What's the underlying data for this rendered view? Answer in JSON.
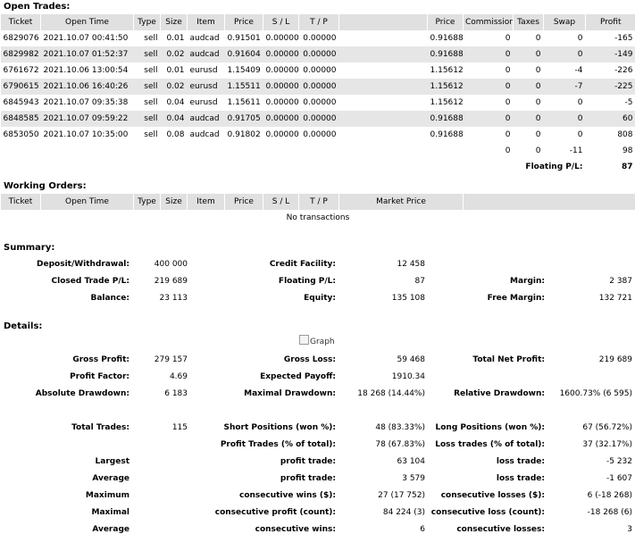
{
  "open_trades": {
    "title": "Open Trades:",
    "headers": [
      "Ticket",
      "Open Time",
      "Type",
      "Size",
      "Item",
      "Price",
      "S / L",
      "T / P",
      "",
      "Price",
      "Commission",
      "Taxes",
      "Swap",
      "Profit"
    ],
    "rows": [
      [
        "6829076",
        "2021.10.07 00:41:50",
        "sell",
        "0.01",
        "audcad",
        "0.91501",
        "0.00000",
        "0.00000",
        "",
        "0.91688",
        "0",
        "0",
        "0",
        "-165"
      ],
      [
        "6829982",
        "2021.10.07 01:52:37",
        "sell",
        "0.02",
        "audcad",
        "0.91604",
        "0.00000",
        "0.00000",
        "",
        "0.91688",
        "0",
        "0",
        "0",
        "-149"
      ],
      [
        "6761672",
        "2021.10.06 13:00:54",
        "sell",
        "0.01",
        "eurusd",
        "1.15409",
        "0.00000",
        "0.00000",
        "",
        "1.15612",
        "0",
        "0",
        "-4",
        "-226"
      ],
      [
        "6790615",
        "2021.10.06 16:40:26",
        "sell",
        "0.02",
        "eurusd",
        "1.15511",
        "0.00000",
        "0.00000",
        "",
        "1.15612",
        "0",
        "0",
        "-7",
        "-225"
      ],
      [
        "6845943",
        "2021.10.07 09:35:38",
        "sell",
        "0.04",
        "eurusd",
        "1.15611",
        "0.00000",
        "0.00000",
        "",
        "1.15612",
        "0",
        "0",
        "0",
        "-5"
      ],
      [
        "6848585",
        "2021.10.07 09:59:22",
        "sell",
        "0.04",
        "audcad",
        "0.91705",
        "0.00000",
        "0.00000",
        "",
        "0.91688",
        "0",
        "0",
        "0",
        "60"
      ],
      [
        "6853050",
        "2021.10.07 10:35:00",
        "sell",
        "0.08",
        "audcad",
        "0.91802",
        "0.00000",
        "0.00000",
        "",
        "0.91688",
        "0",
        "0",
        "0",
        "808"
      ]
    ],
    "totals": {
      "commission": "0",
      "taxes": "0",
      "swap": "-11",
      "profit": "98"
    },
    "floating_label": "Floating P/L:",
    "floating_value": "87"
  },
  "working_orders": {
    "title": "Working Orders:",
    "headers": [
      "Ticket",
      "Open Time",
      "Type",
      "Size",
      "Item",
      "Price",
      "S / L",
      "T / P",
      "Market Price",
      ""
    ],
    "empty_text": "No transactions"
  },
  "summary": {
    "title": "Summary:",
    "deposit_label": "Deposit/Withdrawal:",
    "deposit_value": "400 000",
    "credit_label": "Credit Facility:",
    "credit_value": "12 458",
    "closed_label": "Closed Trade P/L:",
    "closed_value": "219 689",
    "floating_label": "Floating P/L:",
    "floating_value": "87",
    "margin_label": "Margin:",
    "margin_value": "2 387",
    "balance_label": "Balance:",
    "balance_value": "23 113",
    "equity_label": "Equity:",
    "equity_value": "135 108",
    "free_margin_label": "Free Margin:",
    "free_margin_value": "132 721"
  },
  "details": {
    "title": "Details:",
    "graph_alt": "Graph",
    "rows": [
      {
        "l1": "Gross Profit:",
        "v1": "279 157",
        "l2": "Gross Loss:",
        "v2": "59 468",
        "l3": "Total Net Profit:",
        "v3": "219 689"
      },
      {
        "l1": "Profit Factor:",
        "v1": "4.69",
        "l2": "Expected Payoff:",
        "v2": "1910.34",
        "l3": "",
        "v3": ""
      },
      {
        "l1": "Absolute Drawdown:",
        "v1": "6 183",
        "l2": "Maximal Drawdown:",
        "v2": "18 268 (14.44%)",
        "l3": "Relative Drawdown:",
        "v3": "1600.73% (6 595)"
      },
      {
        "l1": "",
        "v1": "",
        "l2": "",
        "v2": "",
        "l3": "",
        "v3": ""
      },
      {
        "l1": "Total Trades:",
        "v1": "115",
        "l2": "Short Positions (won %):",
        "v2": "48 (83.33%)",
        "l3": "Long Positions (won %):",
        "v3": "67 (56.72%)"
      },
      {
        "l1": "",
        "v1": "",
        "l2": "Profit Trades (% of total):",
        "v2": "78 (67.83%)",
        "l3": "Loss trades (% of total):",
        "v3": "37 (32.17%)"
      },
      {
        "l1": "Largest",
        "v1": "",
        "l2": "profit trade:",
        "v2": "63 104",
        "l3": "loss trade:",
        "v3": "-5 232"
      },
      {
        "l1": "Average",
        "v1": "",
        "l2": "profit trade:",
        "v2": "3 579",
        "l3": "loss trade:",
        "v3": "-1 607"
      },
      {
        "l1": "Maximum",
        "v1": "",
        "l2": "consecutive wins ($):",
        "v2": "27 (17 752)",
        "l3": "consecutive losses ($):",
        "v3": "6 (-18 268)"
      },
      {
        "l1": "Maximal",
        "v1": "",
        "l2": "consecutive profit (count):",
        "v2": "84 224 (3)",
        "l3": "consecutive loss (count):",
        "v3": "-18 268 (6)"
      },
      {
        "l1": "Average",
        "v1": "",
        "l2": "consecutive wins:",
        "v2": "6",
        "l3": "consecutive losses:",
        "v3": "3"
      }
    ]
  }
}
